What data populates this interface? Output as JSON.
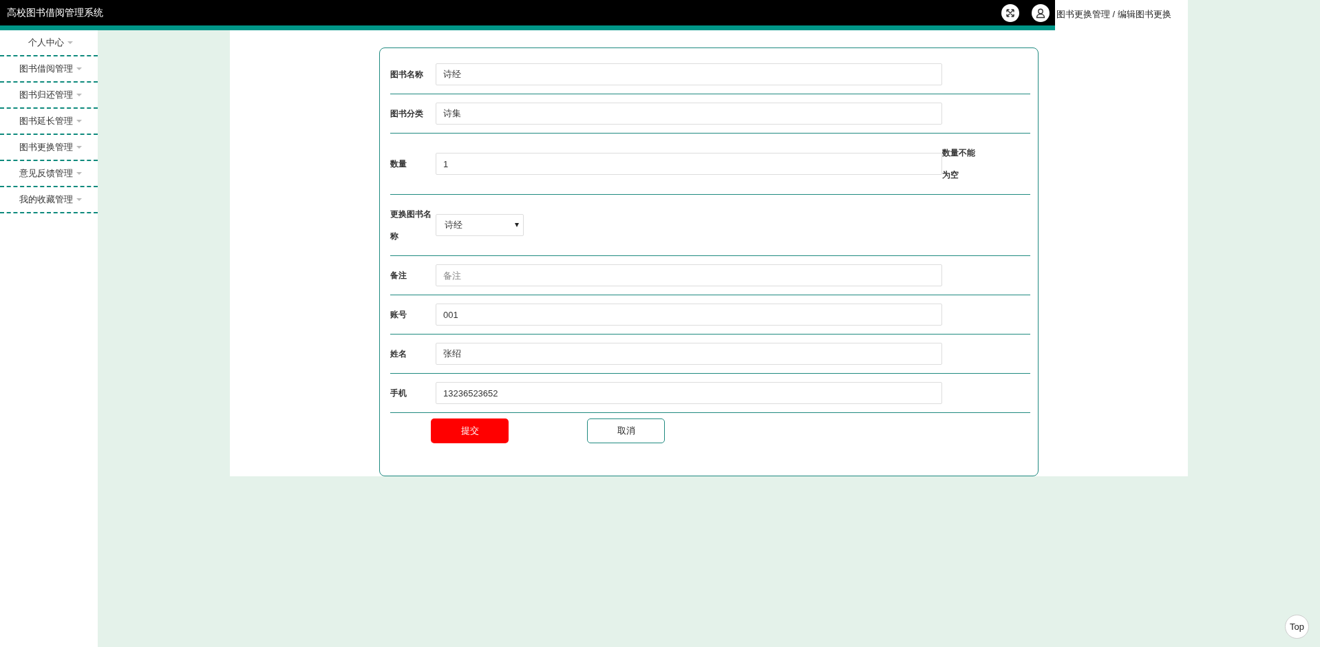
{
  "header": {
    "title": "高校图书借阅管理系统"
  },
  "breadcrumb": "图书更换管理 / 编辑图书更换",
  "sidebar": {
    "items": [
      {
        "label": "个人中心"
      },
      {
        "label": "图书借阅管理"
      },
      {
        "label": "图书归还管理"
      },
      {
        "label": "图书延长管理"
      },
      {
        "label": "图书更换管理"
      },
      {
        "label": "意见反馈管理"
      },
      {
        "label": "我的收藏管理"
      }
    ]
  },
  "form": {
    "fields": [
      {
        "kind": "input",
        "label": "图书名称",
        "value": "诗经"
      },
      {
        "kind": "input",
        "label": "图书分类",
        "value": "诗集"
      },
      {
        "kind": "input",
        "label": "数量",
        "value": "1",
        "error": "数量不能为空"
      },
      {
        "kind": "select",
        "label": "更换图书名称",
        "value": "诗经"
      },
      {
        "kind": "input",
        "label": "备注",
        "placeholder": "备注"
      },
      {
        "kind": "input",
        "label": "账号",
        "value": "001"
      },
      {
        "kind": "input",
        "label": "姓名",
        "value": "张绍"
      },
      {
        "kind": "input",
        "label": "手机",
        "value": "13236523652"
      }
    ],
    "buttons": [
      {
        "kind": "primary",
        "label": "提交"
      },
      {
        "kind": "outline",
        "label": "取消"
      }
    ]
  },
  "back_to_top": "Top"
}
